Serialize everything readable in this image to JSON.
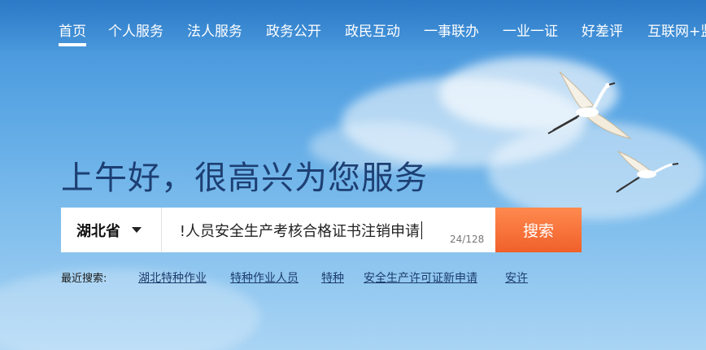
{
  "nav": {
    "items": [
      {
        "label": "首页",
        "active": true
      },
      {
        "label": "个人服务"
      },
      {
        "label": "法人服务"
      },
      {
        "label": "政务公开"
      },
      {
        "label": "政民互动"
      },
      {
        "label": "一事联办"
      },
      {
        "label": "一业一证"
      },
      {
        "label": "好差评"
      },
      {
        "label": "互联网+监"
      }
    ]
  },
  "hero": {
    "greeting": "上午好，很高兴为您服务"
  },
  "search": {
    "region": "湖北省",
    "value": "!人员安全生产考核合格证书注销申请",
    "counter": "24/128",
    "button_label": "搜索"
  },
  "recent": {
    "label": "最近搜索:",
    "items": [
      "湖北特种作业",
      "特种作业人员",
      "特种",
      "安全生产许可证新申请",
      "安许"
    ]
  },
  "colors": {
    "button": "#f0602a",
    "greeting": "#1d3f73",
    "link": "#1c3d6e"
  }
}
